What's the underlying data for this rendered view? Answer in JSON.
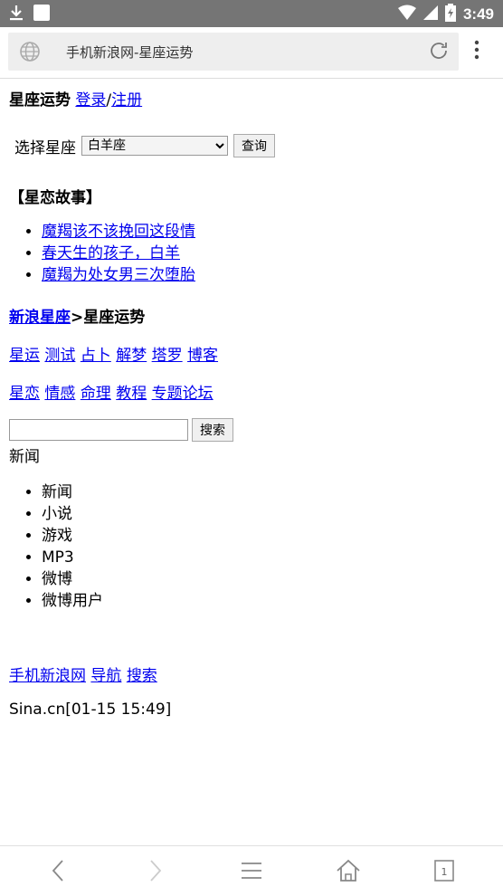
{
  "status": {
    "time": "3:49",
    "icons": [
      "download-icon",
      "photo-icon",
      "wifi-icon",
      "signal-icon",
      "battery-icon"
    ]
  },
  "urlbar": {
    "title": "手机新浪网-星座运势"
  },
  "header": {
    "title": "星座运势",
    "login": "登录",
    "sep": "/",
    "register": "注册"
  },
  "selector": {
    "label": "选择星座",
    "selected": "白羊座",
    "button": "查询"
  },
  "story": {
    "title": "【星恋故事】",
    "items": [
      "魔羯该不该挽回这段情",
      "春天生的孩子，白羊",
      "魔羯为处女男三次堕胎"
    ]
  },
  "breadcrumb": {
    "home": "新浪星座",
    "current": ">星座运势"
  },
  "links_row1": [
    "星运",
    "测试",
    "占卜",
    "解梦",
    "塔罗",
    "博客"
  ],
  "links_row2": [
    "星恋",
    "情感",
    "命理",
    "教程",
    "专题论坛"
  ],
  "search": {
    "button": "搜索",
    "value": "",
    "category_label": "新闻",
    "options": [
      "新闻",
      "小说",
      "游戏",
      "MP3",
      "微博",
      "微博用户"
    ]
  },
  "footer": {
    "links": [
      "手机新浪网",
      "导航",
      "搜索"
    ],
    "stamp": "Sina.cn[01-15 15:49]"
  },
  "bottomnav": {
    "tab_count": "1"
  }
}
